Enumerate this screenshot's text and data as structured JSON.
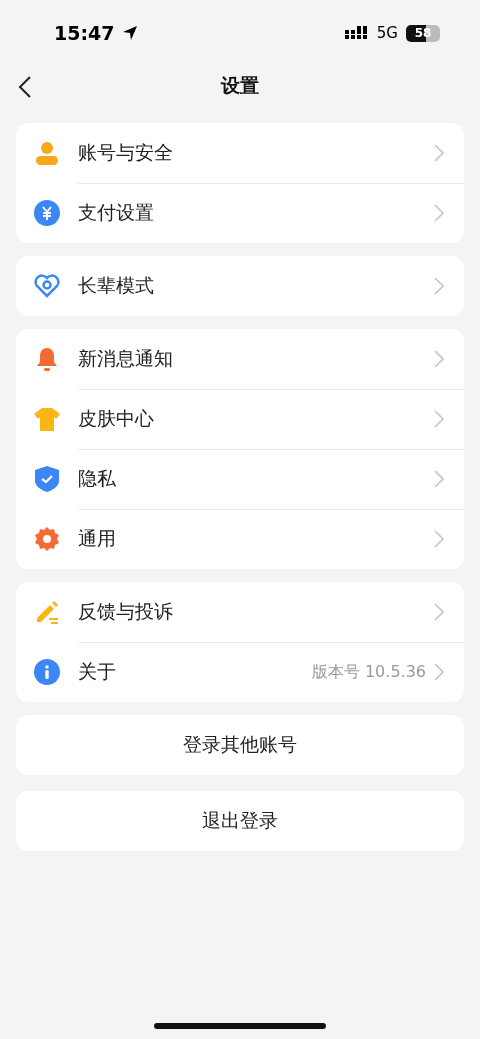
{
  "status_bar": {
    "time": "15:47",
    "network": "5G",
    "battery": "58"
  },
  "nav": {
    "title": "设置"
  },
  "groups": [
    {
      "items": [
        {
          "label": "账号与安全"
        },
        {
          "label": "支付设置"
        }
      ]
    },
    {
      "items": [
        {
          "label": "长辈模式"
        }
      ]
    },
    {
      "items": [
        {
          "label": "新消息通知"
        },
        {
          "label": "皮肤中心"
        },
        {
          "label": "隐私"
        },
        {
          "label": "通用"
        }
      ]
    },
    {
      "items": [
        {
          "label": "反馈与投诉"
        },
        {
          "label": "关于",
          "value": "版本号 10.5.36"
        }
      ]
    }
  ],
  "buttons": [
    {
      "label": "登录其他账号"
    },
    {
      "label": "退出登录"
    }
  ]
}
